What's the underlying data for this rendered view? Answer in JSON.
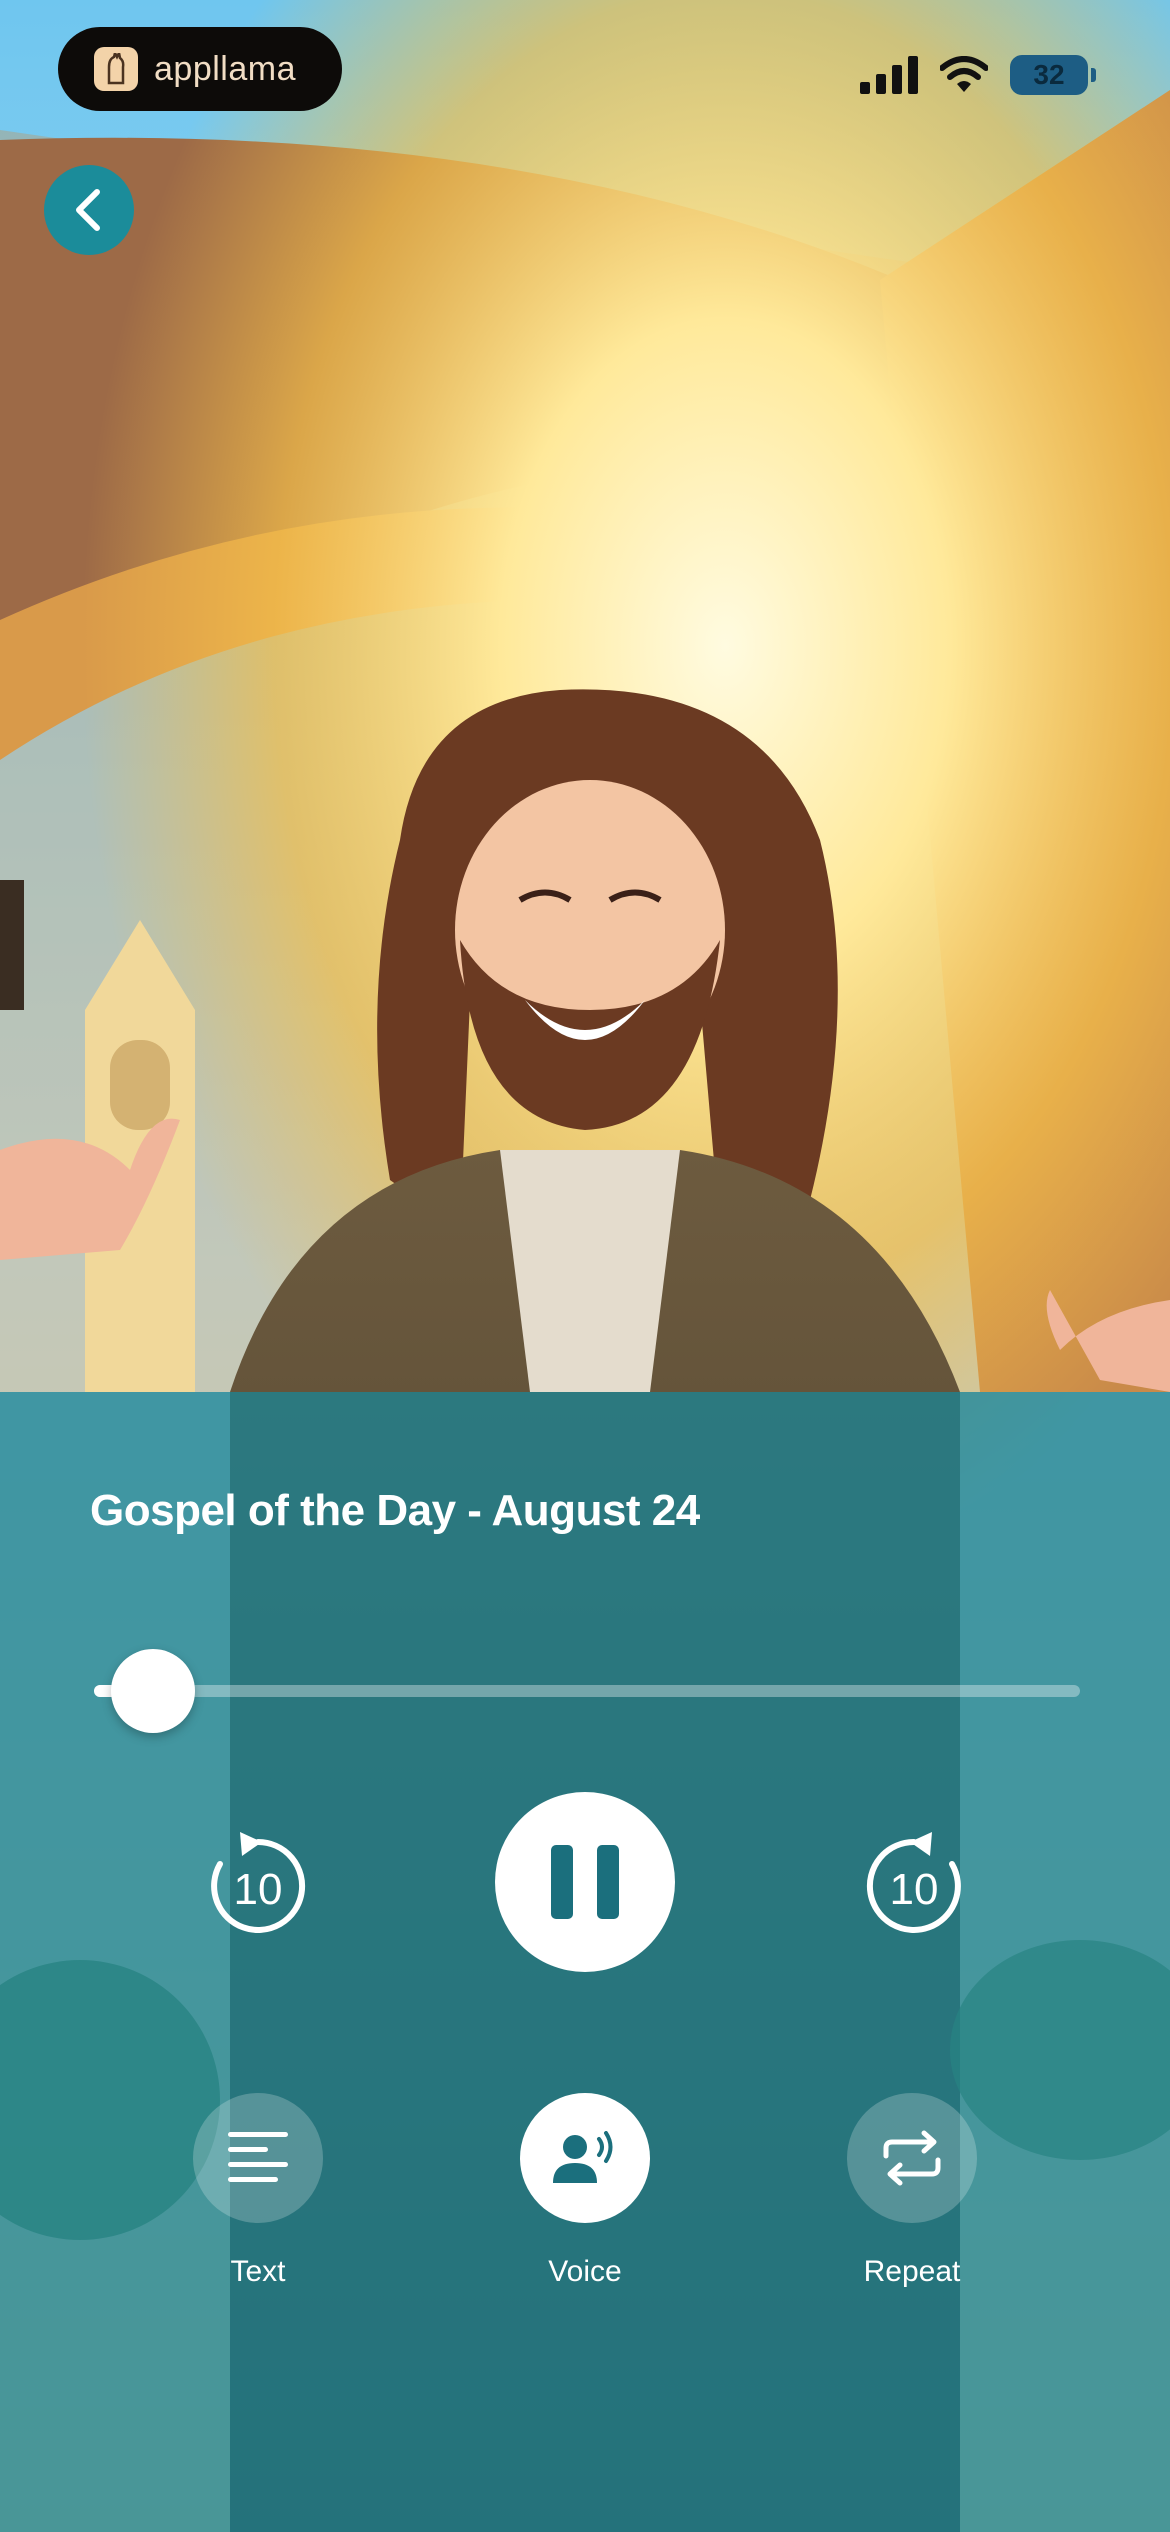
{
  "status_bar": {
    "brand": "appllama",
    "battery": "32",
    "icons": [
      "signal-icon",
      "wifi-icon",
      "battery-icon"
    ]
  },
  "nav": {
    "back_icon": "chevron-left-icon"
  },
  "player": {
    "title": "Gospel of the Day - August 24",
    "progress": 0.06,
    "skip_back_seconds": "10",
    "skip_forward_seconds": "10",
    "state": "playing"
  },
  "options": {
    "text_label": "Text",
    "voice_label": "Voice",
    "repeat_label": "Repeat",
    "selected": "voice"
  },
  "colors": {
    "accent": "#1b8c9a",
    "panel": "#1e8291",
    "icon": "#1b6f7d"
  }
}
